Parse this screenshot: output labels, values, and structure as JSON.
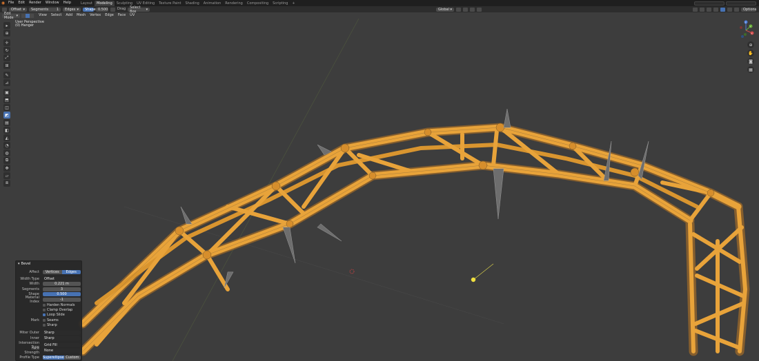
{
  "menubar": {
    "items": [
      "File",
      "Edit",
      "Render",
      "Window",
      "Help"
    ],
    "workspaces": [
      "Layout",
      "Modeling",
      "Sculpting",
      "UV Editing",
      "Texture Paint",
      "Shading",
      "Animation",
      "Rendering",
      "Compositing",
      "Scripting"
    ],
    "active_workspace": "Modeling",
    "add_tab": "+"
  },
  "toolheader": {
    "mode_dropdown": "Offset",
    "segments_label": "Segments",
    "segments_value": "1",
    "affect_dropdown": "Edges",
    "shape_label": "Shape",
    "shape_value": "0.500",
    "drag_label": "Drag",
    "drag_dropdown": "Select Box",
    "transform_orientation": "Global",
    "options": "Options"
  },
  "viewport_header": {
    "mode": "Edit Mode",
    "menus": [
      "View",
      "Select",
      "Add",
      "Mesh",
      "Vertex",
      "Edge",
      "Face",
      "UV"
    ]
  },
  "viewport_info": {
    "line1": "User Perspective",
    "line2": "(0) Hanger"
  },
  "gizmo": {
    "x": "X",
    "y": "Y",
    "z": "Z"
  },
  "bevel_panel": {
    "title": "Bevel",
    "affect_label": "Affect",
    "affect_options": [
      "Vertices",
      "Edges"
    ],
    "width_type_label": "Width Type",
    "width_type_value": "Offset",
    "width_label": "Width",
    "width_value": "0.221 m",
    "segments_label": "Segments",
    "segments_value": "3",
    "shape_label": "Shape",
    "shape_value": "0.500",
    "material_label": "Material Index",
    "material_value": "-1",
    "harden_normals": "Harden Normals",
    "clamp_overlap": "Clamp Overlap",
    "loop_slide": "Loop Slide",
    "mark_label": "Mark",
    "seams": "Seams",
    "sharp": "Sharp",
    "miter_outer_label": "Miter Outer",
    "miter_outer_value": "Sharp",
    "inner_label": "Inner",
    "inner_value": "Sharp",
    "intersection_label": "Intersection Type",
    "intersection_value": "Grid Fill",
    "face_strength_label": "Face Strength",
    "face_strength_value": "None",
    "profile_type_label": "Profile Type",
    "profile_type_options": [
      "Superellipse",
      "Custom"
    ]
  },
  "colors": {
    "accent": "#4772b3",
    "mesh_selected": "#e8a33a",
    "viewport_bg": "#3d3d3d"
  }
}
